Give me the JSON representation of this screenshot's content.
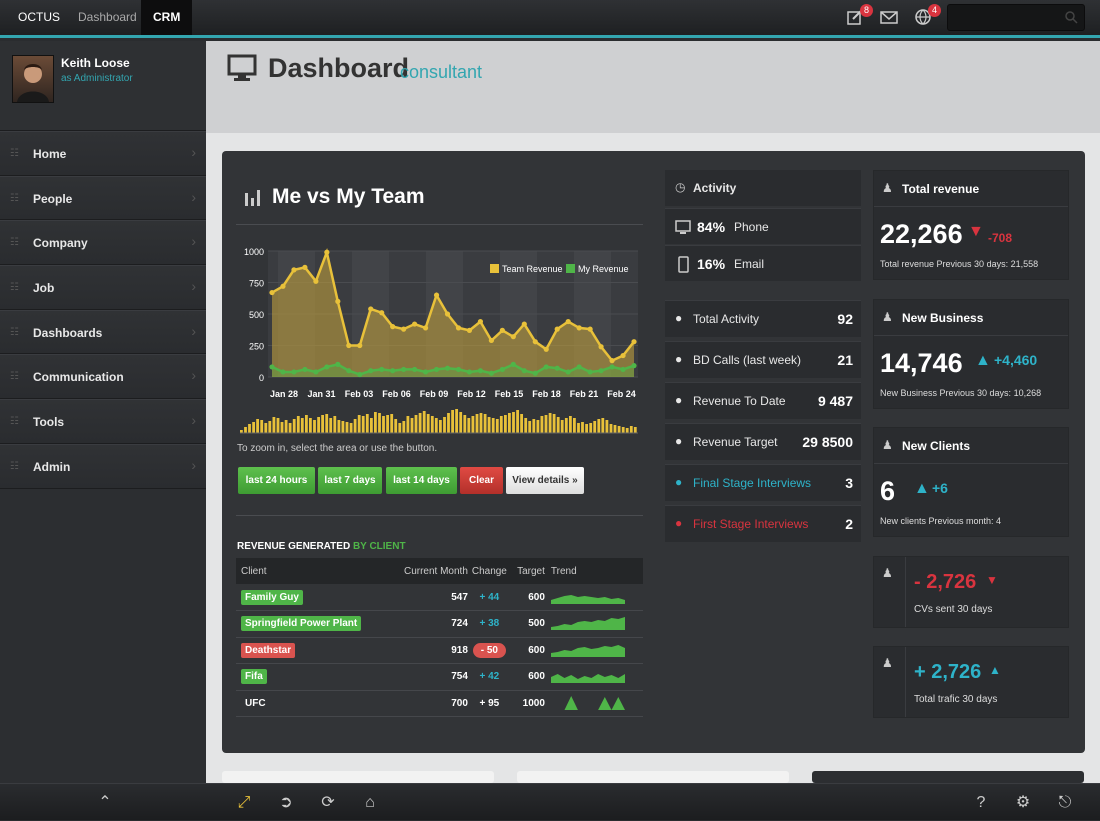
{
  "topbar": {
    "brand": "OCTUS",
    "nav": [
      "Dashboard",
      "CRM"
    ],
    "notifications": {
      "edit_count": "8",
      "globe_count": "4"
    }
  },
  "profile": {
    "name": "Keith Loose",
    "role": "as Administrator"
  },
  "sidebar": {
    "items": [
      {
        "label": "Home",
        "icon": "home-icon"
      },
      {
        "label": "People",
        "icon": "people-icon"
      },
      {
        "label": "Company",
        "icon": "company-icon"
      },
      {
        "label": "Job",
        "icon": "job-icon"
      },
      {
        "label": "Dashboards",
        "icon": "dashboards-icon"
      },
      {
        "label": "Communication",
        "icon": "communication-icon"
      },
      {
        "label": "Tools",
        "icon": "tools-icon"
      },
      {
        "label": "Admin",
        "icon": "admin-icon"
      }
    ]
  },
  "header": {
    "title": "Dashboard",
    "subtitle": "consultant"
  },
  "chart_data": {
    "type": "area",
    "title": "Me vs My Team",
    "x": [
      "Jan 28",
      "Jan 31",
      "Feb 03",
      "Feb 06",
      "Feb 09",
      "Feb 12",
      "Feb 15",
      "Feb 18",
      "Feb 21",
      "Feb 24"
    ],
    "y_ticks": [
      "1000",
      "750",
      "500",
      "250",
      "0"
    ],
    "ylim": [
      0,
      1000
    ],
    "legend": "top-right",
    "series": [
      {
        "name": "Team Revenue",
        "color": "#e8c13a",
        "values": [
          670,
          720,
          850,
          870,
          760,
          990,
          600,
          250,
          250,
          540,
          510,
          400,
          380,
          420,
          390,
          650,
          500,
          390,
          370,
          440,
          290,
          370,
          320,
          420,
          280,
          220,
          380,
          440,
          390,
          380,
          240,
          130,
          170,
          280
        ]
      },
      {
        "name": "My Revenue",
        "color": "#4fb548",
        "values": [
          80,
          40,
          40,
          60,
          40,
          80,
          100,
          50,
          20,
          50,
          60,
          50,
          60,
          60,
          40,
          60,
          70,
          60,
          40,
          50,
          30,
          60,
          100,
          50,
          30,
          80,
          70,
          40,
          80,
          40,
          50,
          80,
          60,
          90
        ]
      }
    ],
    "navigator": [
      30,
      60,
      90,
      110,
      140,
      130,
      100,
      120,
      160,
      150,
      110,
      130,
      100,
      140,
      170,
      150,
      180,
      150,
      130,
      160,
      180,
      190,
      150,
      170,
      130,
      120,
      110,
      100,
      140,
      180,
      170,
      190,
      150,
      210,
      200,
      170,
      180,
      190,
      140,
      100,
      120,
      170,
      150,
      180,
      200,
      220,
      190,
      170,
      150,
      130,
      160,
      200,
      230,
      240,
      210,
      180,
      150,
      170,
      190,
      200,
      190,
      160,
      150,
      140,
      170,
      180,
      200,
      210,
      230,
      190,
      150,
      120,
      140,
      130,
      170,
      180,
      200,
      190,
      160,
      130,
      150,
      170,
      150,
      100,
      110,
      90,
      100,
      120,
      140,
      150,
      130,
      90,
      80,
      70,
      60,
      50,
      70,
      60
    ]
  },
  "chart_ui": {
    "zoom_hint": "To zoom in, select the area or use the button.",
    "buttons": [
      "last 24 hours",
      "last 7 days",
      "last 14 days",
      "Clear",
      "View details »"
    ]
  },
  "revenue_table": {
    "title_main": "REVENUE GENERATED",
    "title_accent": "BY CLIENT",
    "columns": [
      "Client",
      "Current Month",
      "Change",
      "Target",
      "Trend"
    ],
    "rows": [
      {
        "client": "Family Guy",
        "current": "547",
        "change": "+ 44",
        "target": "600",
        "tag": "green",
        "neg": false
      },
      {
        "client": "Springfield Power Plant",
        "current": "724",
        "change": "+ 38",
        "target": "500",
        "tag": "green",
        "neg": false
      },
      {
        "client": "Deathstar",
        "current": "918",
        "change": "- 50",
        "target": "600",
        "tag": "red",
        "neg": true
      },
      {
        "client": "Fifa",
        "current": "754",
        "change": "+ 42",
        "target": "600",
        "tag": "green",
        "neg": false
      },
      {
        "client": "UFC",
        "current": "700",
        "change": "+ 95",
        "target": "1000",
        "tag": "none",
        "neg": false
      }
    ]
  },
  "activity": {
    "title": "Activity",
    "phone_pct": "84%",
    "phone_label": "Phone",
    "email_pct": "16%",
    "email_label": "Email"
  },
  "stats": [
    {
      "label": "Total Activity",
      "value": "92",
      "icon": "users-icon"
    },
    {
      "label": "BD Calls (last week)",
      "value": "21",
      "icon": "user-icon"
    },
    {
      "label": "Revenue To Date",
      "value": "9 487",
      "icon": "cart-icon"
    },
    {
      "label": "Revenue Target",
      "value": "29 8500",
      "icon": "briefcase-icon"
    },
    {
      "label": "Final Stage Interviews",
      "value": "3",
      "icon": "download-icon",
      "accent": "#2eb3c9"
    },
    {
      "label": "First Stage Interviews",
      "value": "2",
      "icon": "target-icon",
      "accent": "#d9343f"
    }
  ],
  "kpis": [
    {
      "title": "Total revenue",
      "value": "22,266",
      "delta": "-708",
      "dir": "down",
      "caption": "Total revenue Previous 30 days: 21,558"
    },
    {
      "title": "New Business",
      "value": "14,746",
      "delta": "+4,460",
      "dir": "up",
      "caption": "New Business Previous 30 days: 10,268"
    },
    {
      "title": "New Clients",
      "value": "6",
      "delta": "+6",
      "dir": "up",
      "caption": "New clients Previous month: 4"
    }
  ],
  "small_stats": [
    {
      "value": "- 2,726",
      "caption": "CVs sent 30 days",
      "dir": "down"
    },
    {
      "value": "+ 2,726",
      "caption": "Total trafic 30 days",
      "dir": "up"
    }
  ],
  "colors": {
    "accent": "#33a6b0",
    "green": "#4fb548",
    "red": "#d9343f",
    "teal": "#2eb3c9",
    "gold": "#e8c13a"
  }
}
